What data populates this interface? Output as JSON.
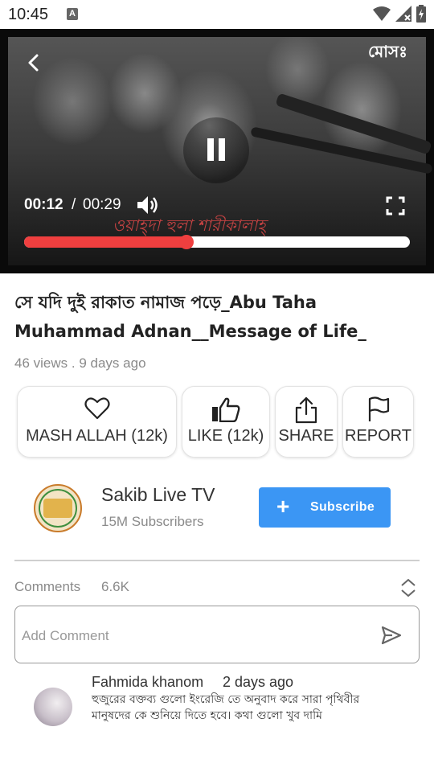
{
  "status_bar": {
    "time": "10:45",
    "notification_letter": "A",
    "icons": [
      "wifi-icon",
      "signal-icon",
      "battery-icon"
    ]
  },
  "player": {
    "current_time": "00:12",
    "separator": "/",
    "total_time": "00:29",
    "progress": 0.42,
    "overlay_logo": "মোসঃ",
    "caption": "ওয়াহ্‌দা হুলা শারীকালাহ্",
    "accent": "#ef3f3f"
  },
  "video": {
    "title": "সে যদি দুই রাকাত নামাজ পড়ে_Abu Taha Muhammad Adnan__Message of Life_",
    "views": "46 views",
    "dot": ".",
    "age": "9 days ago"
  },
  "actions": [
    {
      "label": "MASH ALLAH (12k)",
      "icon": "heart-icon"
    },
    {
      "label": "LIKE (12k)",
      "icon": "thumbs-up-icon"
    },
    {
      "label": "SHARE",
      "icon": "share-icon"
    },
    {
      "label": "REPORT",
      "icon": "flag-icon"
    }
  ],
  "channel": {
    "name": "Sakib Live TV",
    "subscribers": "15M Subscribers",
    "subscribe_label": "Subscribe",
    "subscribe_icon": "+",
    "subscribe_color": "#3b96f4"
  },
  "comments": {
    "label": "Comments",
    "count": "6.6K",
    "input_placeholder": "Add Comment",
    "items": [
      {
        "author": "Fahmida khanom",
        "time": "2 days ago",
        "text": "হুজুরের বক্তব্য গুলো ইংরেজি তে অনুবাদ করে সারা পৃথিবীর মানুষদের কে শুনিয়ে দিতে হবে। কথা গুলো খুব দামি"
      }
    ]
  }
}
